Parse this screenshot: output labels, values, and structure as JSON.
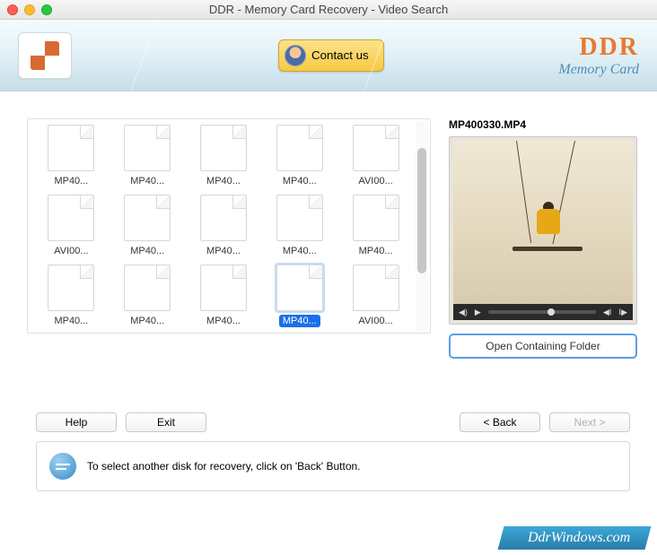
{
  "window": {
    "title": "DDR - Memory Card Recovery - Video Search"
  },
  "banner": {
    "contact_label": "Contact us",
    "brand_main": "DDR",
    "brand_sub": "Memory Card"
  },
  "files": [
    {
      "label": "MP40..."
    },
    {
      "label": "MP40..."
    },
    {
      "label": "MP40..."
    },
    {
      "label": "MP40..."
    },
    {
      "label": "AVI00..."
    },
    {
      "label": "AVI00..."
    },
    {
      "label": "MP40..."
    },
    {
      "label": "MP40..."
    },
    {
      "label": "MP40..."
    },
    {
      "label": "MP40..."
    },
    {
      "label": "MP40..."
    },
    {
      "label": "MP40..."
    },
    {
      "label": "MP40..."
    },
    {
      "label": "MP40...",
      "selected": true
    },
    {
      "label": "AVI00..."
    }
  ],
  "preview": {
    "filename": "MP400330.MP4",
    "open_folder_label": "Open Containing Folder"
  },
  "buttons": {
    "help": "Help",
    "exit": "Exit",
    "back": "< Back",
    "next": "Next >"
  },
  "info": {
    "text": "To select another disk for recovery, click on 'Back' Button."
  },
  "watermark": "DdrWindows.com"
}
